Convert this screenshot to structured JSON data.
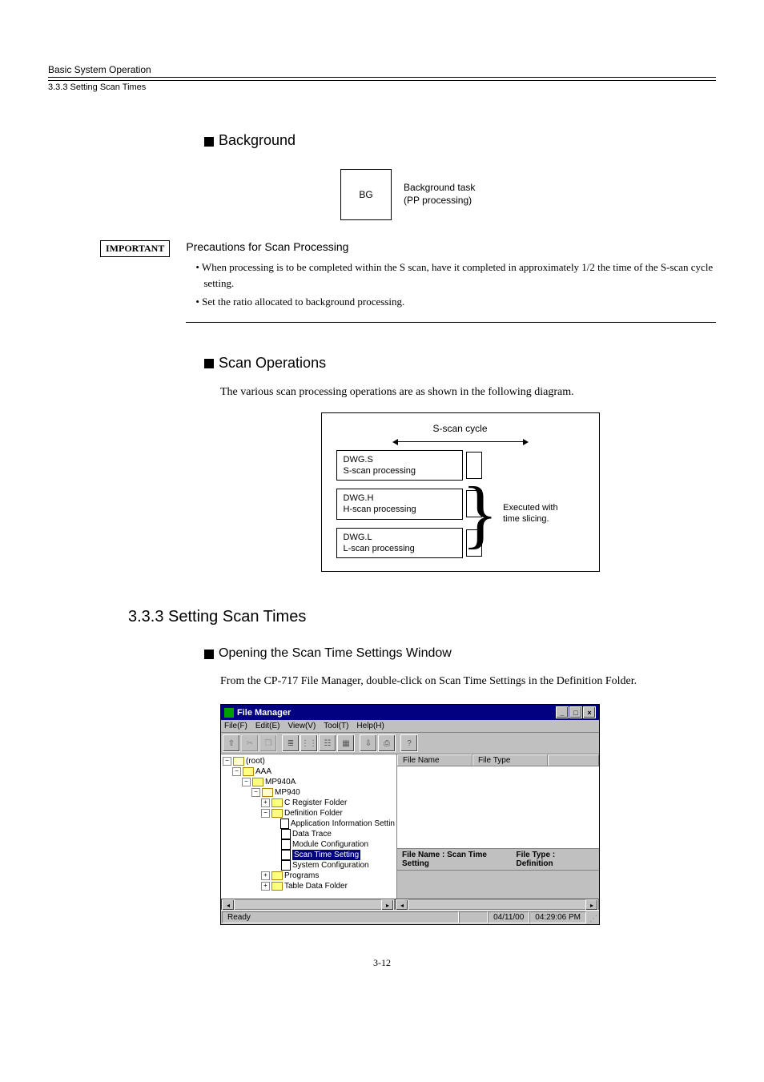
{
  "header": {
    "chapter": "Basic System Operation",
    "section": "3.3.3  Setting Scan Times"
  },
  "body": {
    "background_heading": "Background",
    "bg_box": "BG",
    "bg_label_l1": "Background task",
    "bg_label_l2": "(PP processing)",
    "important_label": "IMPORTANT",
    "precautions_title": "Precautions for Scan Processing",
    "precaution1": "• When processing is to be completed within the S scan, have it completed in approximately 1/2 the time of the S-scan cycle setting.",
    "precaution2": "• Set the ratio allocated to background processing.",
    "scan_ops_heading": "Scan Operations",
    "scan_ops_text": "The various scan processing operations are as shown in the following diagram.",
    "diagram": {
      "cycle": "S-scan cycle",
      "s_name": "DWG.S",
      "s_proc": "S-scan processing",
      "h_name": "DWG.H",
      "h_proc": "H-scan processing",
      "l_name": "DWG.L",
      "l_proc": "L-scan processing",
      "brace_l1": "Executed with",
      "brace_l2": "time slicing."
    },
    "section_num_heading": "3.3.3  Setting Scan Times",
    "opening_heading": "Opening the Scan Time Settings Window",
    "opening_text": "From the CP-717 File Manager, double-click on Scan Time Settings in the Definition Folder."
  },
  "fm": {
    "title": "File Manager",
    "menu": {
      "file": "File(F)",
      "edit": "Edit(E)",
      "view": "View(V)",
      "tool": "Tool(T)",
      "help": "Help(H)"
    },
    "win_min": "_",
    "win_max": "□",
    "win_close": "×",
    "list_cols": {
      "name": "File Name",
      "type": "File Type"
    },
    "tree": {
      "root": "(root)",
      "aaa": "AAA",
      "mp940a": "MP940A",
      "mp940": "MP940",
      "creg": "C Register Folder",
      "deffolder": "Definition Folder",
      "appinfo": "Application Information Settin",
      "datatrace": "Data Trace",
      "modconf": "Module Configuration",
      "scantime": "Scan Time Setting",
      "sysconf": "System Configuration",
      "programs": "Programs",
      "tabledata": "Table Data Folder"
    },
    "info": {
      "fname": "File Name : Scan Time Setting",
      "ftype": "File Type : Definition"
    },
    "status": {
      "ready": "Ready",
      "date": "04/11/00",
      "time": "04:29:06 PM"
    }
  },
  "footer": {
    "pagenum": "3-12"
  }
}
